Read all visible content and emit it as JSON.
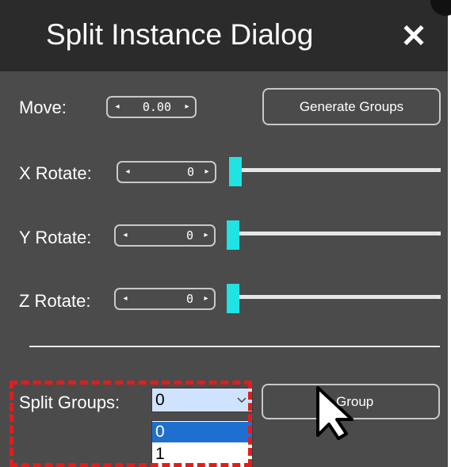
{
  "dialog": {
    "title": "Split Instance Dialog",
    "close_label": "✕"
  },
  "move": {
    "label": "Move:",
    "value": "0.00",
    "left_arrow": "◂",
    "right_arrow": "▸"
  },
  "generate_button": {
    "label": "Generate Groups"
  },
  "x_rotate": {
    "label": "X Rotate:",
    "value": "0",
    "slider_level": 0
  },
  "y_rotate": {
    "label": "Y Rotate:",
    "value": "0",
    "slider_level": 0
  },
  "z_rotate": {
    "label": "Z Rotate:",
    "value": "0",
    "slider_level": 0
  },
  "split_groups": {
    "label": "Split Groups:",
    "selected": "0",
    "options": [
      "0",
      "1"
    ]
  },
  "group_button": {
    "label": "Group"
  },
  "colors": {
    "background": "#4b4b4b",
    "titlebar": "#2b2b2b",
    "slider_thumb": "#20e3e3",
    "highlight": "#e21c1c",
    "option_selected": "#1f6fd1"
  }
}
